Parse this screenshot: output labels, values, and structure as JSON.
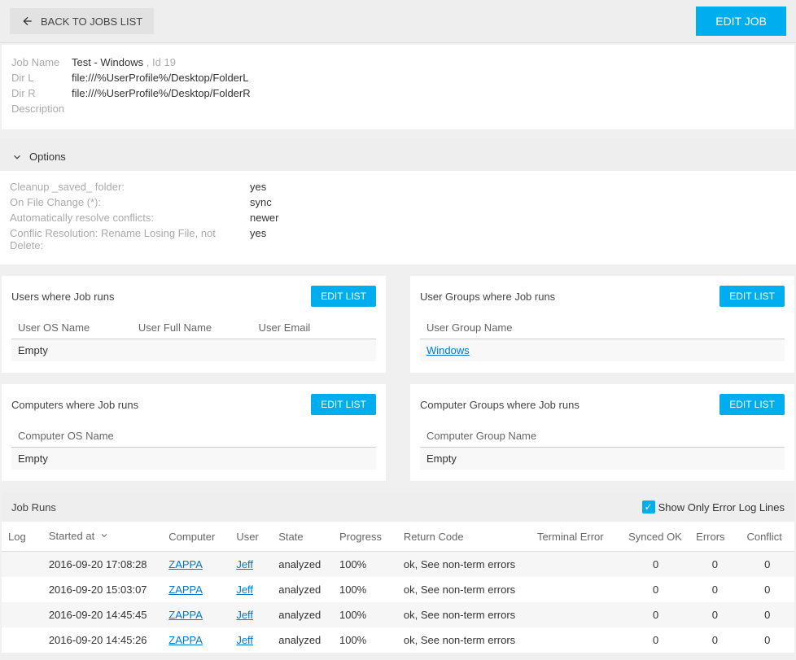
{
  "topbar": {
    "back_label": "BACK TO JOBS LIST",
    "edit_job_label": "EDIT JOB"
  },
  "job": {
    "name_label": "Job Name",
    "name_value": "Test - Windows",
    "id_label": ", Id",
    "id_value": "19",
    "dirl_label": "Dir L",
    "dirl_value": "file:///%UserProfile%/Desktop/FolderL",
    "dirr_label": "Dir R",
    "dirr_value": "file:///%UserProfile%/Desktop/FolderR",
    "desc_label": "Description",
    "desc_value": ""
  },
  "options": {
    "header": "Options",
    "cleanup_label": "Cleanup _saved_ folder:",
    "cleanup_value": "yes",
    "onfile_label": "On File Change (*):",
    "onfile_value": "sync",
    "autoresolve_label": "Automatically resolve conflicts:",
    "autoresolve_value": "newer",
    "conflict_label": "Conflic Resolution: Rename Losing File, not Delete:",
    "conflict_value": "yes"
  },
  "edit_list_label": "EDIT LIST",
  "users_card": {
    "title": "Users where Job runs",
    "col_os": "User OS Name",
    "col_full": "User Full Name",
    "col_email": "User Email",
    "empty_row": "Empty"
  },
  "usergroups_card": {
    "title": "User Groups where Job runs",
    "col_name": "User Group Name",
    "row_value": "Windows"
  },
  "computers_card": {
    "title": "Computers where Job runs",
    "col_name": "Computer OS Name",
    "empty_row": "Empty"
  },
  "computergroups_card": {
    "title": "Computer Groups where Job runs",
    "col_name": "Computer Group Name",
    "empty_row": "Empty"
  },
  "runs": {
    "title": "Job Runs",
    "show_errors_label": "Show Only Error Log Lines",
    "cols": {
      "log": "Log",
      "started": "Started at",
      "computer": "Computer",
      "user": "User",
      "state": "State",
      "progress": "Progress",
      "return_code": "Return Code",
      "terminal_error": "Terminal Error",
      "synced_ok": "Synced OK",
      "errors": "Errors",
      "conflict": "Conflict"
    },
    "rows": [
      {
        "started": "2016-09-20 17:08:28",
        "computer": "ZAPPA",
        "user": "Jeff",
        "state": "analyzed",
        "progress": "100%",
        "return_code": "ok, See non-term errors",
        "terminal_error": "",
        "synced_ok": "0",
        "errors": "0",
        "conflict": "0"
      },
      {
        "started": "2016-09-20 15:03:07",
        "computer": "ZAPPA",
        "user": "Jeff",
        "state": "analyzed",
        "progress": "100%",
        "return_code": "ok, See non-term errors",
        "terminal_error": "",
        "synced_ok": "0",
        "errors": "0",
        "conflict": "0"
      },
      {
        "started": "2016-09-20 14:45:45",
        "computer": "ZAPPA",
        "user": "Jeff",
        "state": "analyzed",
        "progress": "100%",
        "return_code": "ok, See non-term errors",
        "terminal_error": "",
        "synced_ok": "0",
        "errors": "0",
        "conflict": "0"
      },
      {
        "started": "2016-09-20 14:45:26",
        "computer": "ZAPPA",
        "user": "Jeff",
        "state": "analyzed",
        "progress": "100%",
        "return_code": "ok, See non-term errors",
        "terminal_error": "",
        "synced_ok": "0",
        "errors": "0",
        "conflict": "0"
      }
    ]
  }
}
